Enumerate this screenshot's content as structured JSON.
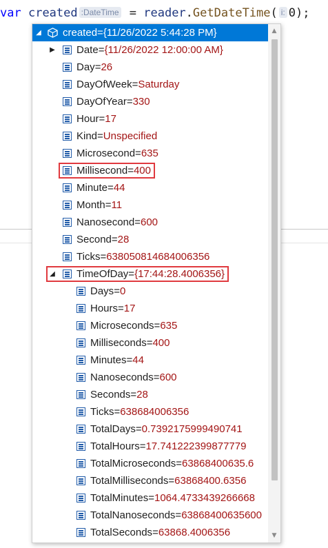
{
  "code": {
    "keyword": "var",
    "variable": "created",
    "type_hint": ":DateTime",
    "assign": " = ",
    "object": "reader",
    "dot": ".",
    "method": "GetDateTime",
    "open_paren": "(",
    "param_hint": "i:",
    "arg": "0",
    "close": ");"
  },
  "datatip": {
    "root": {
      "name": "created",
      "eq": "=",
      "value": "{11/26/2022 5:44:28 PM}",
      "expanded": true,
      "icon": "cube-icon"
    },
    "children": [
      {
        "name": "Date",
        "value": "{11/26/2022 12:00:00 AM}",
        "expandable": true
      },
      {
        "name": "Day",
        "value": "26"
      },
      {
        "name": "DayOfWeek",
        "value": "Saturday"
      },
      {
        "name": "DayOfYear",
        "value": "330"
      },
      {
        "name": "Hour",
        "value": "17"
      },
      {
        "name": "Kind",
        "value": "Unspecified"
      },
      {
        "name": "Microsecond",
        "value": "635"
      },
      {
        "name": "Millisecond",
        "value": "400",
        "highlighted": true
      },
      {
        "name": "Minute",
        "value": "44"
      },
      {
        "name": "Month",
        "value": "11"
      },
      {
        "name": "Nanosecond",
        "value": "600"
      },
      {
        "name": "Second",
        "value": "28"
      },
      {
        "name": "Ticks",
        "value": "638050814684006356"
      },
      {
        "name": "TimeOfDay",
        "value": "{17:44:28.4006356}",
        "expanded": true,
        "highlighted": true
      }
    ],
    "timeofday_children": [
      {
        "name": "Days",
        "value": "0"
      },
      {
        "name": "Hours",
        "value": "17"
      },
      {
        "name": "Microseconds",
        "value": "635"
      },
      {
        "name": "Milliseconds",
        "value": "400"
      },
      {
        "name": "Minutes",
        "value": "44"
      },
      {
        "name": "Nanoseconds",
        "value": "600"
      },
      {
        "name": "Seconds",
        "value": "28"
      },
      {
        "name": "Ticks",
        "value": "638684006356"
      },
      {
        "name": "TotalDays",
        "value": "0.7392175999490741"
      },
      {
        "name": "TotalHours",
        "value": "17.741222399877779"
      },
      {
        "name": "TotalMicroseconds",
        "value": "63868400635.6"
      },
      {
        "name": "TotalMilliseconds",
        "value": "63868400.6356"
      },
      {
        "name": "TotalMinutes",
        "value": "1064.4733439266668"
      },
      {
        "name": "TotalNanoseconds",
        "value": "63868400635600"
      },
      {
        "name": "TotalSeconds",
        "value": "63868.4006356"
      }
    ],
    "icons": {
      "property": "property-icon",
      "pin": "pin-icon",
      "expand": "triangle-right-icon",
      "collapse": "triangle-down-icon"
    }
  },
  "colors": {
    "selection": "#0078d7",
    "value": "#a31515",
    "highlight": "#e0393e",
    "keyword": "#0000ff"
  }
}
